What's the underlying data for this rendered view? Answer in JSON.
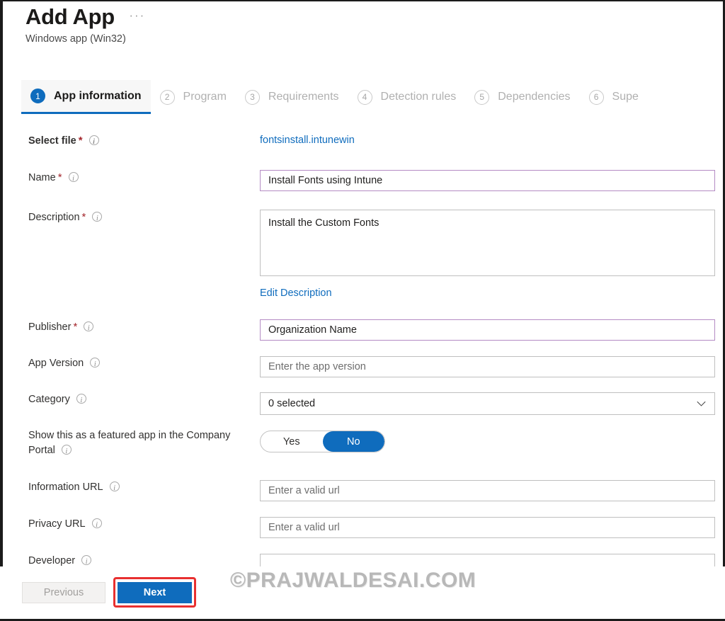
{
  "header": {
    "title": "Add App",
    "subtitle": "Windows app (Win32)",
    "overflow_label": "···"
  },
  "tabs": [
    {
      "num": "1",
      "label": "App information",
      "active": true
    },
    {
      "num": "2",
      "label": "Program",
      "active": false
    },
    {
      "num": "3",
      "label": "Requirements",
      "active": false
    },
    {
      "num": "4",
      "label": "Detection rules",
      "active": false
    },
    {
      "num": "5",
      "label": "Dependencies",
      "active": false
    },
    {
      "num": "6",
      "label": "Supe",
      "active": false
    }
  ],
  "form": {
    "select_file": {
      "label": "Select file",
      "required": "*",
      "file_name": "fontsinstall.intunewin"
    },
    "name": {
      "label": "Name",
      "required": "*",
      "value": "Install Fonts using Intune"
    },
    "description": {
      "label": "Description",
      "required": "*",
      "value": "Install the Custom Fonts",
      "edit_link": "Edit Description"
    },
    "publisher": {
      "label": "Publisher",
      "required": "*",
      "value": "Organization Name"
    },
    "app_version": {
      "label": "App Version",
      "placeholder": "Enter the app version"
    },
    "category": {
      "label": "Category",
      "value": "0 selected"
    },
    "featured_app": {
      "label": "Show this as a featured app in the Company Portal",
      "option_yes": "Yes",
      "option_no": "No",
      "selected": "No"
    },
    "information_url": {
      "label": "Information URL",
      "placeholder": "Enter a valid url"
    },
    "privacy_url": {
      "label": "Privacy URL",
      "placeholder": "Enter a valid url"
    },
    "developer": {
      "label": "Developer",
      "placeholder": ""
    }
  },
  "footer": {
    "previous_label": "Previous",
    "next_label": "Next"
  },
  "watermark": "©PRAJWALDESAI.COM",
  "colors": {
    "accent": "#0f6cbd",
    "required_asterisk": "#a4262c",
    "filled_field_border": "#b48bc4",
    "highlight": "#e83030",
    "link": "#0f6cbd"
  }
}
